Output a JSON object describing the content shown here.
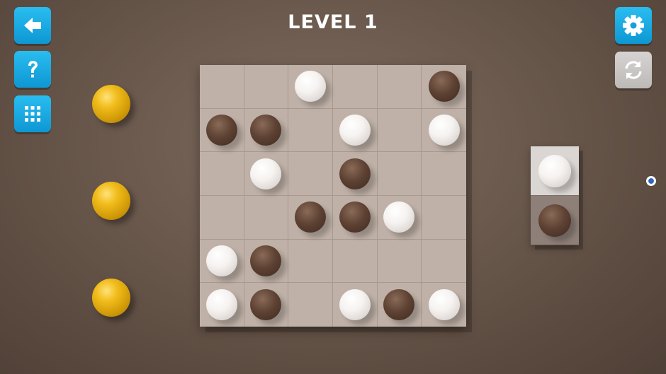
{
  "header": {
    "title": "LEVEL 1"
  },
  "buttons": {
    "back": {
      "icon": "back-arrow-icon",
      "color": "#1aa9e3"
    },
    "help": {
      "icon": "question-mark-icon",
      "color": "#1aa9e3"
    },
    "levels": {
      "icon": "grid-icon",
      "color": "#1aa9e3"
    },
    "settings": {
      "icon": "gear-icon",
      "color": "#1aa9e3"
    },
    "restart": {
      "icon": "refresh-icon",
      "color": "#c9c6c4"
    }
  },
  "stars": {
    "count": 3,
    "color": "#e0a810"
  },
  "board": {
    "rows": 6,
    "cols": 6,
    "cells": [
      [
        "",
        "",
        "white",
        "",
        "",
        "black"
      ],
      [
        "black",
        "black",
        "",
        "white",
        "",
        "white"
      ],
      [
        "",
        "white",
        "",
        "black",
        "",
        ""
      ],
      [
        "",
        "",
        "black",
        "black",
        "white",
        ""
      ],
      [
        "white",
        "black",
        "",
        "",
        "",
        ""
      ],
      [
        "white",
        "black",
        "",
        "white",
        "black",
        "white"
      ]
    ]
  },
  "next_piece": {
    "top": "white",
    "bottom": "black"
  },
  "colors": {
    "background": "#6e5c50",
    "board": "#bfb1a7",
    "white_ball": "#f4f1ef",
    "black_ball": "#4e3629"
  }
}
